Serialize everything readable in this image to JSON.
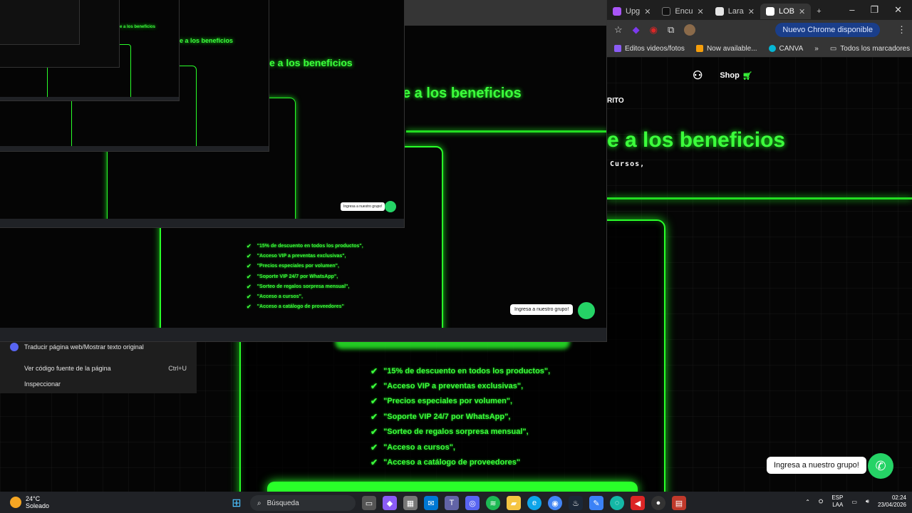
{
  "browser": {
    "tabs": [
      {
        "label": "Upg",
        "color": "#a855f7"
      },
      {
        "label": "Encu",
        "color": "#111111"
      },
      {
        "label": "Lara",
        "color": "#e5e5e5"
      },
      {
        "label": "LOB",
        "color": "#ffffff",
        "active": true
      }
    ],
    "new_chrome_label": "Nuevo Chrome disponible",
    "bookmarks": [
      {
        "label": "Editos videos/fotos",
        "color": "#8b5cf6"
      },
      {
        "label": "Now available...",
        "color": "#f59e0b"
      },
      {
        "label": "CANVA",
        "color": "#06b6d4"
      }
    ],
    "all_bookmarks": "Todos los marcadores"
  },
  "site": {
    "shop_label": "Shop",
    "rito_label": "RITO",
    "hero_title": "e a los beneficios",
    "hero_sub": "Cursos,",
    "benefits": [
      "\"15% de descuento en todos los productos\",",
      "\"Acceso VIP a preventas exclusivas\",",
      "\"Precios especiales por volumen\",",
      "\"Soporte VIP 24/7 por WhatsApp\",",
      "\"Sorteo de regalos sorpresa mensual\",",
      "\"Acceso a cursos\",",
      "\"Acceso a catálogo de proveedores\""
    ],
    "join_group": "Ingresa a nuestro grupo!",
    "nested_title": "e a los beneficios"
  },
  "context_menu": {
    "translate": "Traducir página web/Mostrar texto original",
    "view_source": "Ver código fuente de la página",
    "view_source_shortcut": "Ctrl+U",
    "inspect": "Inspeccionar"
  },
  "taskbar": {
    "temperature": "24°C",
    "weather": "Soleado",
    "search_placeholder": "Búsqueda",
    "lang": "ESP",
    "lang2": "LAA",
    "time": "02:24",
    "date": "23/04/2026"
  }
}
